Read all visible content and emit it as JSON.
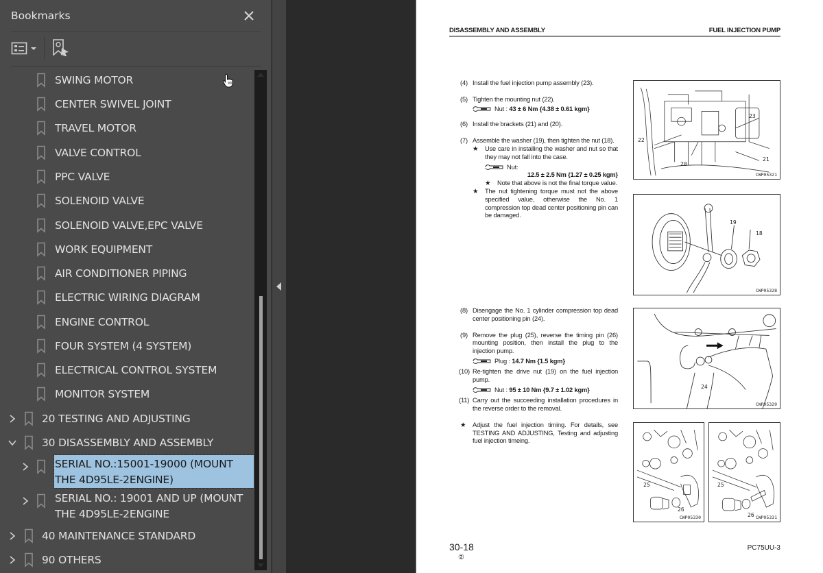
{
  "sidebar": {
    "title": "Bookmarks",
    "close_icon": "close-icon",
    "toolbar": {
      "options_icon": "list-options-icon",
      "find_icon": "find-current-bookmark-icon"
    },
    "items": [
      {
        "label": "SWING MOTOR",
        "level": 2
      },
      {
        "label": "CENTER SWIVEL JOINT",
        "level": 2
      },
      {
        "label": "TRAVEL MOTOR",
        "level": 2
      },
      {
        "label": "VALVE CONTROL",
        "level": 2
      },
      {
        "label": "PPC VALVE",
        "level": 2
      },
      {
        "label": "SOLENOID VALVE",
        "level": 2
      },
      {
        "label": "SOLENOID VALVE,EPC VALVE",
        "level": 2
      },
      {
        "label": "WORK EQUIPMENT",
        "level": 2
      },
      {
        "label": "AIR CONDITIONER PIPING",
        "level": 2
      },
      {
        "label": "ELECTRIC WIRING DIAGRAM",
        "level": 2
      },
      {
        "label": "ENGINE CONTROL",
        "level": 2
      },
      {
        "label": "FOUR SYSTEM (4 SYSTEM)",
        "level": 2
      },
      {
        "label": "ELECTRICAL CONTROL SYSTEM",
        "level": 2
      },
      {
        "label": "MONITOR SYSTEM",
        "level": 2
      },
      {
        "label": "20 TESTING AND ADJUSTING",
        "level": 1,
        "expanded": false
      },
      {
        "label": "30 DISASSEMBLY AND ASSEMBLY",
        "level": 1,
        "expanded": true
      },
      {
        "label": "SERIAL NO.:15001-19000 (MOUNT THE 4D95LE-2ENGINE)",
        "level": 2,
        "expanded": false,
        "selected": true
      },
      {
        "label": "SERIAL NO.: 19001 AND UP (MOUNT THE 4D95LE-2ENGINE",
        "level": 2,
        "expanded": false
      },
      {
        "label": "40 MAINTENANCE STANDARD",
        "level": 1,
        "expanded": false
      },
      {
        "label": "90 OTHERS",
        "level": 1,
        "expanded": false
      }
    ]
  },
  "page": {
    "header_left": "DISASSEMBLY AND ASSEMBLY",
    "header_right": "FUEL INJECTION PUMP",
    "steps": {
      "s4": {
        "num": "(4)",
        "text": "Install the fuel injection pump assembly (23)."
      },
      "s5": {
        "num": "(5)",
        "text": "Tighten the mounting nut (22).",
        "torque_label": "Nut : ",
        "torque_value": "43 ± 6 Nm {4.38 ± 0.61 kgm}"
      },
      "s6": {
        "num": "(6)",
        "text": "Install the brackets (21) and (20)."
      },
      "s7": {
        "num": "(7)",
        "text": "Assemble the washer (19), then tighten the nut (18).",
        "note1": "Use care in installing the washer and nut so that they may not fall into the case.",
        "torque_label": "Nut:",
        "torque_value": "12.5 ± 2.5 Nm {1.27 ± 0.25 kgm}",
        "note2": "Note that above is not the final torque value.",
        "note3": "The nut tightening torque must not the above specified value, otherwise the No. 1 compression top dead center positioning pin can be damaged."
      },
      "s8": {
        "num": "(8)",
        "text": "Disengage the No. 1 cylinder compression top dead center positioning pin (24)."
      },
      "s9": {
        "num": "(9)",
        "text": "Remove the plug (25), reverse the timing pin (26) mounting position, then install the plug to the injection pump.",
        "torque_label": "Plug : ",
        "torque_value": "14.7 Nm {1.5 kgm}"
      },
      "s10": {
        "num": "(10)",
        "text": "Re-tighten the drive nut (19) on the fuel injection pump.",
        "torque_label": "Nut : ",
        "torque_value": "95 ± 10 Nm {9.7 ± 1.02 kgm}"
      },
      "s11": {
        "num": "(11)",
        "text": "Carry out the succeeding installation procedures in the reverse order to the removal."
      },
      "final_note": "Adjust the fuel injection timing. For details, see TESTING AND ADJUSTING, Testing and adjusting fuel injection timeing."
    },
    "star": "★",
    "figures": [
      {
        "code": "CWP05321",
        "callouts": [
          "23",
          "22",
          "20",
          "21"
        ]
      },
      {
        "code": "CWP05328",
        "callouts": [
          "19",
          "18"
        ]
      },
      {
        "code": "CWP05329",
        "callouts": [
          "24"
        ]
      },
      {
        "code": "CWP05330",
        "callouts": [
          "25",
          "26"
        ]
      },
      {
        "code": "CWP05331",
        "callouts": [
          "25",
          "26"
        ]
      }
    ],
    "page_number": "30-18",
    "revision": "②",
    "model": "PC75UU-3"
  }
}
